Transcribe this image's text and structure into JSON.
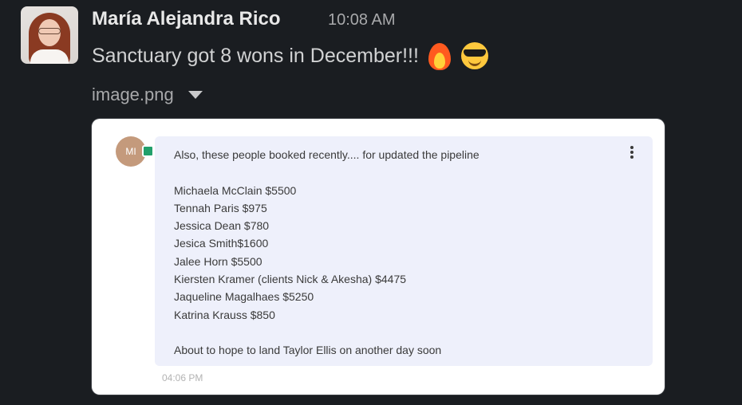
{
  "message": {
    "sender": "María Alejandra Rico",
    "timestamp": "10:08 AM",
    "text": "Sanctuary got 8 wons in December!!!",
    "emojis": [
      "fire-emoji",
      "sunglasses-emoji"
    ]
  },
  "attachment": {
    "filename": "image.png",
    "preview": {
      "avatar_initials": "MI",
      "intro": "Also, these people booked recently.... for updated the pipeline",
      "bookings": [
        "Michaela McClain $5500",
        "Tennah Paris $975",
        "Jessica Dean $780",
        "Jesica Smith$1600",
        "Jalee Horn $5500",
        "Kiersten Kramer (clients Nick & Akesha) $4475",
        "Jaqueline Magalhaes $5250",
        "Katrina Krauss $850"
      ],
      "closing": "About to hope to land Taylor Ellis on another day soon",
      "time": "04:06 PM"
    }
  },
  "colors": {
    "background": "#1a1d21",
    "sender": "#e8e8e8",
    "message_text": "#d1d2d3",
    "muted": "#a8a9ab",
    "bubble": "#eef0fb",
    "status_green": "#22a06b"
  }
}
